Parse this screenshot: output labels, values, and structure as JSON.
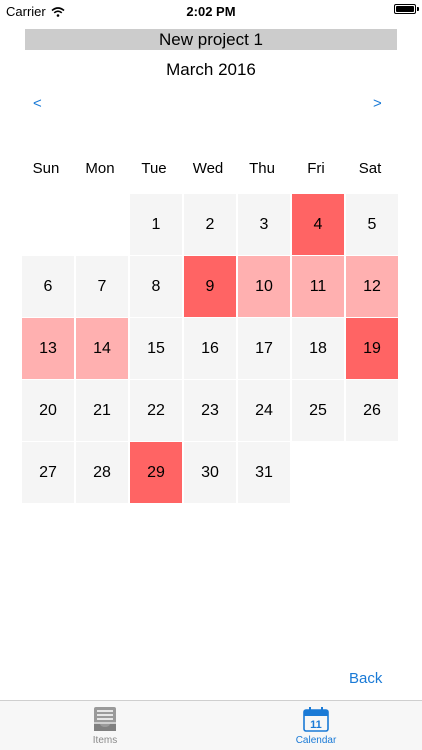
{
  "status_bar": {
    "carrier": "Carrier",
    "time": "2:02 PM",
    "battery_level": 1.0
  },
  "header": {
    "project_title": "New project 1",
    "month_title": "March 2016"
  },
  "nav": {
    "prev_label": "<",
    "next_label": ">"
  },
  "weekdays": [
    "Sun",
    "Mon",
    "Tue",
    "Wed",
    "Thu",
    "Fri",
    "Sat"
  ],
  "calendar": {
    "first_weekday_index": 2,
    "days": [
      {
        "day": "1",
        "level": 0
      },
      {
        "day": "2",
        "level": 0
      },
      {
        "day": "3",
        "level": 0
      },
      {
        "day": "4",
        "level": 2
      },
      {
        "day": "5",
        "level": 0
      },
      {
        "day": "6",
        "level": 0
      },
      {
        "day": "7",
        "level": 0
      },
      {
        "day": "8",
        "level": 0
      },
      {
        "day": "9",
        "level": 2
      },
      {
        "day": "10",
        "level": 1
      },
      {
        "day": "11",
        "level": 1
      },
      {
        "day": "12",
        "level": 1
      },
      {
        "day": "13",
        "level": 1
      },
      {
        "day": "14",
        "level": 1
      },
      {
        "day": "15",
        "level": 0
      },
      {
        "day": "16",
        "level": 0
      },
      {
        "day": "17",
        "level": 0
      },
      {
        "day": "18",
        "level": 0
      },
      {
        "day": "19",
        "level": 2
      },
      {
        "day": "20",
        "level": 0
      },
      {
        "day": "21",
        "level": 0
      },
      {
        "day": "22",
        "level": 0
      },
      {
        "day": "23",
        "level": 0
      },
      {
        "day": "24",
        "level": 0
      },
      {
        "day": "25",
        "level": 0
      },
      {
        "day": "26",
        "level": 0
      },
      {
        "day": "27",
        "level": 0
      },
      {
        "day": "28",
        "level": 0
      },
      {
        "day": "29",
        "level": 2
      },
      {
        "day": "30",
        "level": 0
      },
      {
        "day": "31",
        "level": 0
      }
    ]
  },
  "actions": {
    "back_label": "Back"
  },
  "tab_bar": {
    "items_label": "Items",
    "calendar_label": "Calendar",
    "calendar_icon_day": "11",
    "active_tab": "Calendar"
  },
  "colors": {
    "accent": "#1a7ad6",
    "title_bg": "#cccccc",
    "cell_bg": "#f5f5f5",
    "highlight_light": "#ffb0b0",
    "highlight_strong": "#ff6464"
  }
}
